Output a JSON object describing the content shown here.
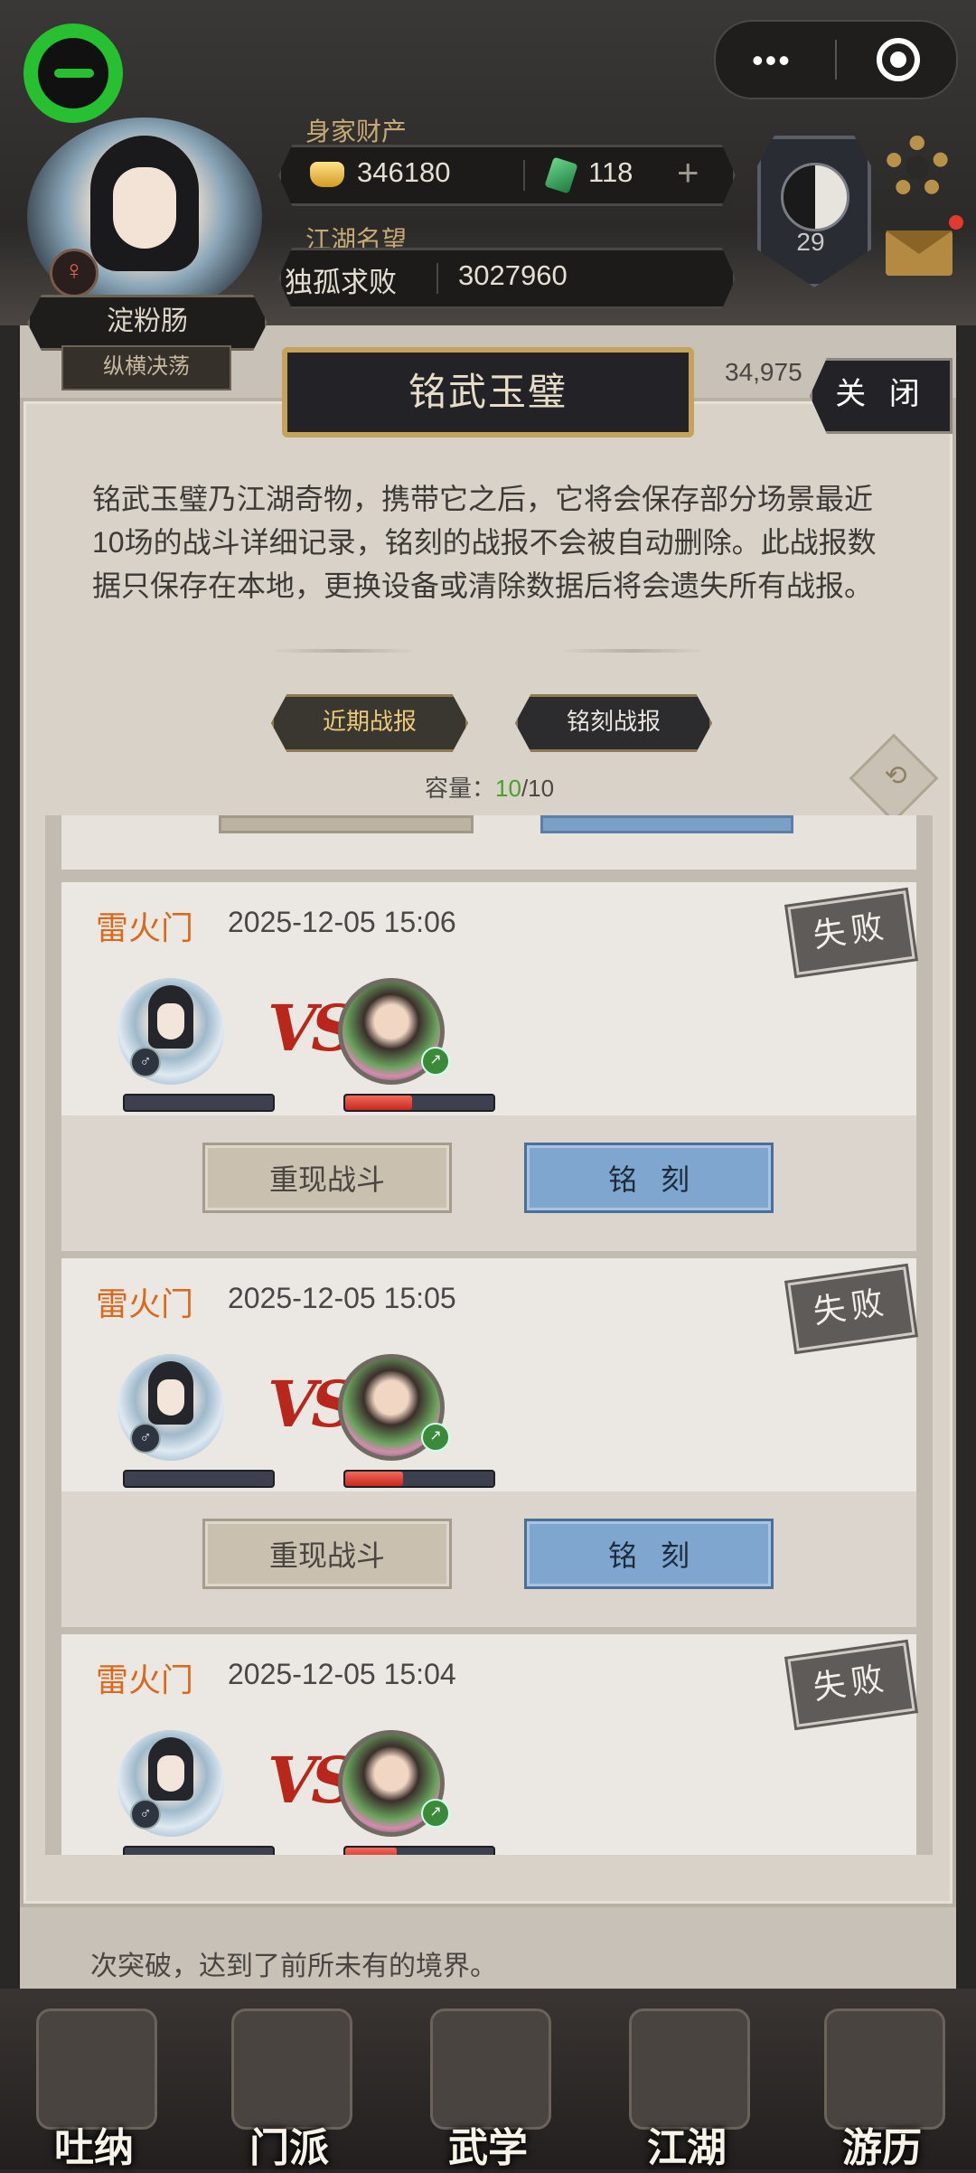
{
  "hud": {
    "assets_label": "身家财产",
    "gold": "346180",
    "jade": "118",
    "reputation_label": "江湖名望",
    "reputation_title": "独孤求败",
    "reputation_value": "3027960",
    "player_name": "淀粉肠",
    "player_subtitle": "纵横决荡",
    "gender_symbol": "♀",
    "level": "29"
  },
  "background": {
    "score_partial": "34,975",
    "line1": "次突破，达到了前所未有的境界。"
  },
  "modal": {
    "title": "铭武玉璧",
    "close": "关 闭",
    "description": "铭武玉璧乃江湖奇物，携带它之后，它将会保存部分场景最近10场的战斗详细记录，铭刻的战报不会被自动删除。此战报数据只保存在本地，更换设备或清除数据后将会遗失所有战报。",
    "tabs": [
      {
        "label": "近期战报",
        "active": true
      },
      {
        "label": "铭刻战报",
        "active": false
      }
    ],
    "capacity_label": "容量：",
    "capacity_used": "10",
    "capacity_total": "/10"
  },
  "battles": [
    {
      "sect": "雷火门",
      "datetime": "2025-12-05 15:06",
      "result": "失败",
      "player_hp": 0.0,
      "enemy_hp": 0.45,
      "replay": "重现战斗",
      "engrave": "铭刻"
    },
    {
      "sect": "雷火门",
      "datetime": "2025-12-05 15:05",
      "result": "失败",
      "player_hp": 0.0,
      "enemy_hp": 0.39,
      "replay": "重现战斗",
      "engrave": "铭刻"
    },
    {
      "sect": "雷火门",
      "datetime": "2025-12-05 15:04",
      "result": "失败",
      "player_hp": 0.0,
      "enemy_hp": 0.35,
      "replay": "重现战斗",
      "engrave": "铭刻"
    }
  ],
  "vs_text": "VS",
  "male_symbol": "♂",
  "nav": [
    {
      "label": "吐纳",
      "icon": "gourd-icon"
    },
    {
      "label": "门派",
      "icon": "banner-icon"
    },
    {
      "label": "武学",
      "icon": "scroll-book-icon"
    },
    {
      "label": "江湖",
      "icon": "straw-hat-icon"
    },
    {
      "label": "游历",
      "icon": "horse-icon"
    }
  ],
  "colors": {
    "sect": "#d86a1e",
    "engrave_button": "#7fa6cf",
    "wechat_green": "#27c030",
    "capacity_green": "#4aa02a"
  }
}
